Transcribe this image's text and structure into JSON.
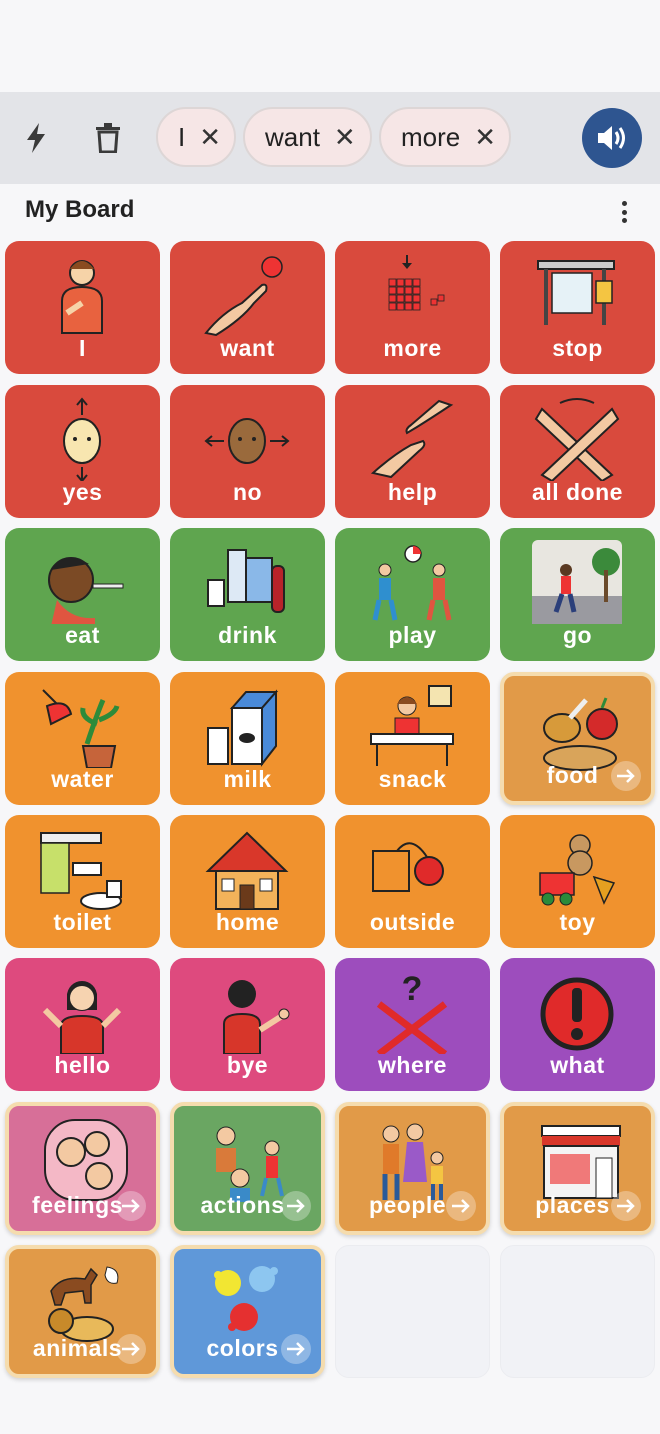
{
  "toolbar": {
    "chips": [
      {
        "label": "I"
      },
      {
        "label": "want"
      },
      {
        "label": "more"
      }
    ],
    "clear_icon": "lightning-icon",
    "delete_icon": "trash-icon",
    "speak_icon": "speaker-icon"
  },
  "board": {
    "title": "My Board",
    "menu_icon": "more-vertical-icon"
  },
  "tiles": [
    {
      "label": "I",
      "color": "#d94a3d",
      "icon": "boy-pointing-self-icon"
    },
    {
      "label": "want",
      "color": "#d94a3d",
      "icon": "hand-reaching-icon"
    },
    {
      "label": "more",
      "color": "#d94a3d",
      "icon": "more-blocks-icon"
    },
    {
      "label": "stop",
      "color": "#d94a3d",
      "icon": "bus-stop-icon"
    },
    {
      "label": "yes",
      "color": "#d94a3d",
      "icon": "head-nod-icon"
    },
    {
      "label": "no",
      "color": "#d94a3d",
      "icon": "head-shake-icon"
    },
    {
      "label": "help",
      "color": "#d94a3d",
      "icon": "helping-hands-icon"
    },
    {
      "label": "all done",
      "color": "#d94a3d",
      "icon": "crossed-hands-icon"
    },
    {
      "label": "eat",
      "color": "#5fa54f",
      "icon": "boy-eating-icon"
    },
    {
      "label": "drink",
      "color": "#5fa54f",
      "icon": "drinks-icon"
    },
    {
      "label": "play",
      "color": "#5fa54f",
      "icon": "kids-playing-ball-icon"
    },
    {
      "label": "go",
      "color": "#5fa54f",
      "icon": "person-walking-icon"
    },
    {
      "label": "water",
      "color": "#f0922e",
      "icon": "watering-plant-icon"
    },
    {
      "label": "milk",
      "color": "#f0922e",
      "icon": "milk-carton-icon"
    },
    {
      "label": "snack",
      "color": "#f0922e",
      "icon": "woman-at-table-icon"
    },
    {
      "label": "food",
      "color": "#e19a48",
      "icon": "food-icon",
      "folder": true
    },
    {
      "label": "toilet",
      "color": "#f0922e",
      "icon": "toilet-icon"
    },
    {
      "label": "home",
      "color": "#f0922e",
      "icon": "house-icon"
    },
    {
      "label": "outside",
      "color": "#f0922e",
      "icon": "outside-box-icon"
    },
    {
      "label": "toy",
      "color": "#f0922e",
      "icon": "toys-icon"
    },
    {
      "label": "hello",
      "color": "#de4a7e",
      "icon": "girl-waving-icon"
    },
    {
      "label": "bye",
      "color": "#de4a7e",
      "icon": "boy-waving-icon"
    },
    {
      "label": "where",
      "color": "#9d4dbd",
      "icon": "question-cross-icon"
    },
    {
      "label": "what",
      "color": "#9d4dbd",
      "icon": "exclamation-icon"
    },
    {
      "label": "feelings",
      "color": "#d76f98",
      "icon": "faces-icon",
      "folder": true
    },
    {
      "label": "actions",
      "color": "#6aa662",
      "icon": "kids-actions-icon",
      "folder": true
    },
    {
      "label": "people",
      "color": "#e19a48",
      "icon": "family-icon",
      "folder": true
    },
    {
      "label": "places",
      "color": "#e19a48",
      "icon": "store-icon",
      "folder": true
    },
    {
      "label": "animals",
      "color": "#e19a48",
      "icon": "animals-icon",
      "folder": true
    },
    {
      "label": "colors",
      "color": "#5f98d9",
      "icon": "paint-splash-icon",
      "folder": true
    }
  ]
}
